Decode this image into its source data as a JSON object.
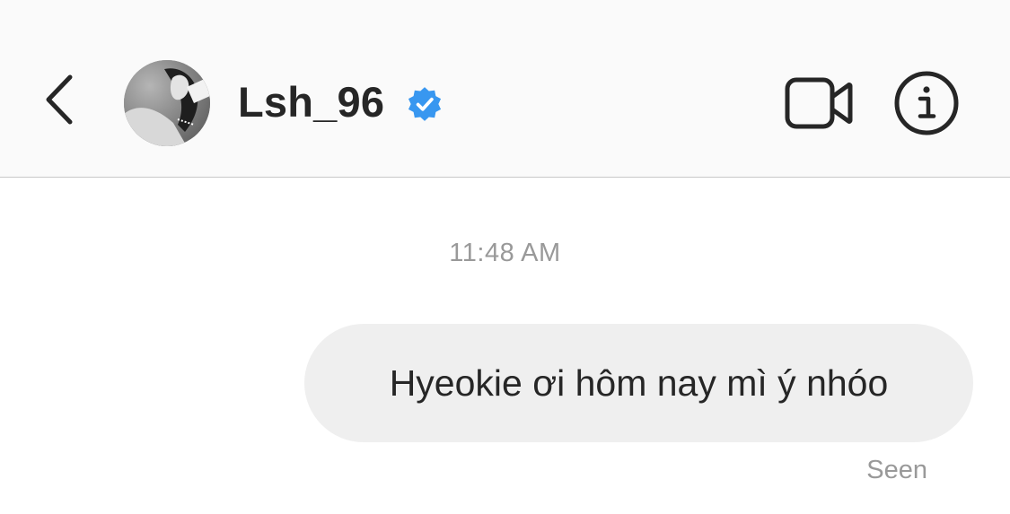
{
  "header": {
    "back_icon": "chevron-left-icon",
    "avatar_icon": "profile-photo",
    "username": "Lsh_96",
    "verified_icon": "verified-badge-icon",
    "video_icon": "video-camera-icon",
    "info_icon": "info-icon",
    "background_color": "#fafafa"
  },
  "thread": {
    "timestamp": "11:48 AM",
    "messages": [
      {
        "text": "Hyeokie ơi hôm nay mì ý nhóo",
        "sender": "self",
        "bubble_color": "#efefef"
      }
    ],
    "status": "Seen"
  },
  "colors": {
    "text_primary": "#262626",
    "text_secondary": "#999999",
    "verified_blue": "#3897f0"
  }
}
